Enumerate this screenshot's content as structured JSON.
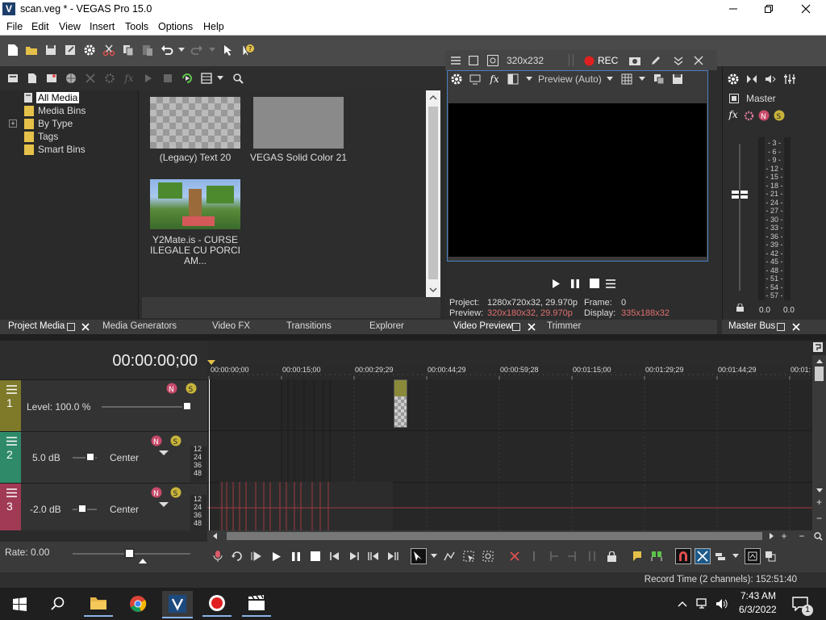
{
  "window": {
    "title": "scan.veg * - VEGAS Pro 15.0"
  },
  "menu": {
    "items": [
      "File",
      "Edit",
      "View",
      "Insert",
      "Tools",
      "Options",
      "Help"
    ]
  },
  "project_media": {
    "tree": [
      "All Media",
      "Media Bins",
      "By Type",
      "Tags",
      "Smart Bins"
    ],
    "thumbs": [
      {
        "label": "(Legacy) Text 20"
      },
      {
        "label": "VEGAS Solid Color 21"
      },
      {
        "label": "Y2Mate.is - CURSE ILEGALE CU PORCI AM..."
      }
    ],
    "tabs": [
      "Project Media",
      "Media Generators",
      "Video FX",
      "Transitions",
      "Explorer"
    ]
  },
  "preview": {
    "size": "320x232",
    "rec_label": "REC",
    "mode": "Preview (Auto)",
    "project_label": "Project:",
    "project_value": "1280x720x32, 29.970p",
    "preview_label": "Preview:",
    "preview_value": "320x180x32, 29.970p",
    "frame_label": "Frame:",
    "frame_value": "0",
    "display_label": "Display:",
    "display_value": "335x188x32",
    "tabs": [
      "Video Preview",
      "Trimmer"
    ]
  },
  "master": {
    "title": "Master",
    "scale": [
      "3",
      "6",
      "9",
      "12",
      "15",
      "18",
      "21",
      "24",
      "27",
      "30",
      "33",
      "36",
      "39",
      "42",
      "45",
      "48",
      "51",
      "54",
      "57"
    ],
    "left_value": "0.0",
    "right_value": "0.0",
    "tab": "Master Bus"
  },
  "timeline": {
    "timecode": "00:00:00;00",
    "ruler": [
      "00:00:00;00",
      "00:00:15;00",
      "00:00:29;29",
      "00:00:44;29",
      "00:00:59;28",
      "00:01:15;00",
      "00:01:29;29",
      "00:01:44;29",
      "00:01:"
    ],
    "tracks": [
      {
        "num": "1",
        "label": "Level: 100.0 %",
        "color": "#7e7a2a"
      },
      {
        "num": "2",
        "label": "5.0 dB",
        "pan": "Center",
        "color": "#2f8a6a"
      },
      {
        "num": "3",
        "label": "-2.0 dB",
        "pan": "Center",
        "color": "#a03a55"
      }
    ],
    "meter_scale": [
      "12",
      "24",
      "36",
      "48"
    ],
    "rate": "Rate: 0.00"
  },
  "status": {
    "record_time": "Record Time (2 channels): 152:51:40"
  },
  "taskbar": {
    "time": "7:43 AM",
    "date": "6/3/2022",
    "badge": "1"
  },
  "colors": {
    "accent": "#4a7fc0",
    "rec": "#e02020",
    "solo": "#c8b43a",
    "mute": "#c84a6a"
  }
}
